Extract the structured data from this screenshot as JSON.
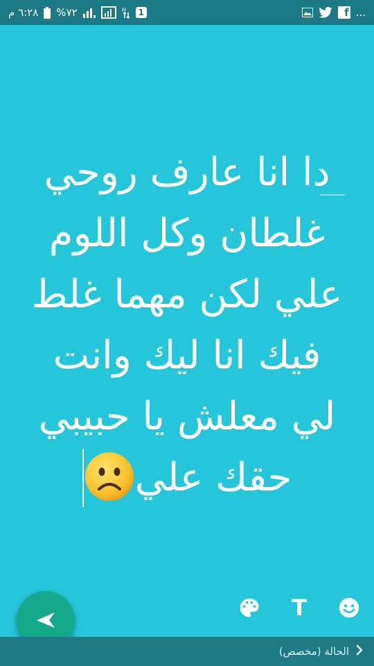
{
  "status_bar": {
    "time": "٦:٢٨ م",
    "battery": "%٧٢",
    "sim_label": "1",
    "overflow": "..."
  },
  "editor": {
    "lines": [
      "دا انا عارف روحي",
      "غلطان وكل اللوم",
      "علي لكن مهما غلط",
      "فيك انا ليك وانت",
      "لي معلش يا حبيبي"
    ],
    "last_line_text": "حقك علي",
    "emoji": "frowning-face"
  },
  "tools": {
    "text_label": "T",
    "palette_icon": "palette-icon",
    "emoji_icon": "smiley-icon"
  },
  "send_button": {
    "icon": "send-arrow-icon"
  },
  "footer": {
    "caption": "الحالة (مخصص)",
    "chevron": "chevron-right-icon"
  },
  "colors": {
    "background": "#26c6da",
    "status_bar": "#1c7a86",
    "fab": "#14a98a",
    "footer": "#1e7b86"
  }
}
